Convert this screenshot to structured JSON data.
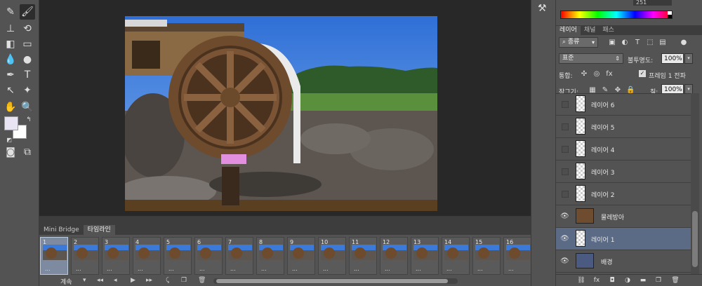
{
  "color_panel": {
    "value": "251"
  },
  "layers_panel": {
    "tabs": [
      "레이어",
      "채널",
      "패스"
    ],
    "active_tab": 0,
    "filter_kind": "종류",
    "blend_mode": "표준",
    "opacity_label": "불투명도:",
    "opacity_value": "100%",
    "unify_label": "통합:",
    "propagate_label": "프레임 1 전파",
    "lock_label": "잠그기:",
    "fill_label": "칠:",
    "fill_value": "100%",
    "layers": [
      {
        "name": "레이어 6",
        "visible": false,
        "selected": false,
        "thumb": "transparent"
      },
      {
        "name": "레이어 5",
        "visible": false,
        "selected": false,
        "thumb": "transparent"
      },
      {
        "name": "레이어 4",
        "visible": false,
        "selected": false,
        "thumb": "transparent"
      },
      {
        "name": "레이어 3",
        "visible": false,
        "selected": false,
        "thumb": "transparent"
      },
      {
        "name": "레이어 2",
        "visible": false,
        "selected": false,
        "thumb": "transparent"
      },
      {
        "name": "물레방아",
        "visible": true,
        "selected": false,
        "thumb": "image"
      },
      {
        "name": "레이어 1",
        "visible": true,
        "selected": true,
        "thumb": "transparent"
      },
      {
        "name": "배경",
        "visible": true,
        "selected": false,
        "thumb": "image"
      }
    ]
  },
  "timeline": {
    "tabs": [
      "Mini Bridge",
      "타임라인"
    ],
    "active_tab": 1,
    "frames": [
      {
        "num": "1",
        "time": "..."
      },
      {
        "num": "2",
        "time": "..."
      },
      {
        "num": "3",
        "time": "..."
      },
      {
        "num": "4",
        "time": "..."
      },
      {
        "num": "5",
        "time": "..."
      },
      {
        "num": "6",
        "time": "..."
      },
      {
        "num": "7",
        "time": "..."
      },
      {
        "num": "8",
        "time": "..."
      },
      {
        "num": "9",
        "time": "..."
      },
      {
        "num": "10",
        "time": "..."
      },
      {
        "num": "11",
        "time": "..."
      },
      {
        "num": "12",
        "time": "..."
      },
      {
        "num": "13",
        "time": "..."
      },
      {
        "num": "14",
        "time": "..."
      },
      {
        "num": "15",
        "time": "..."
      },
      {
        "num": "16",
        "time": "..."
      }
    ],
    "selected_frame": 0,
    "loop_label": "계속"
  },
  "tools": [
    "brush-icon",
    "stamp-icon",
    "eraser-icon",
    "blur-icon",
    "pen-icon",
    "type-icon",
    "select-arrow-icon",
    "hand-icon",
    "zoom-icon"
  ],
  "colors": {
    "foreground": "#e8e4f4",
    "background": "#ffffff"
  }
}
